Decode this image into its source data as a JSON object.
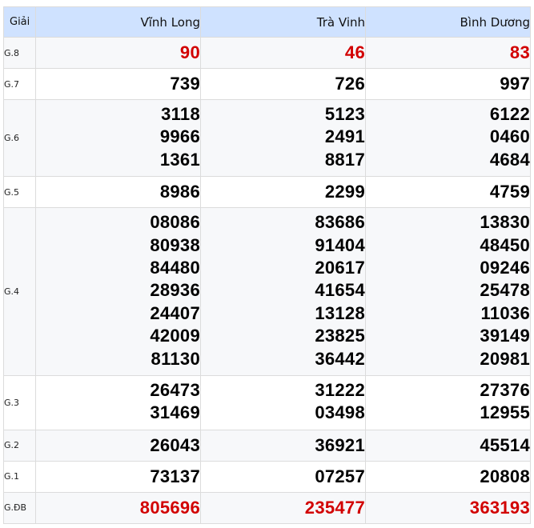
{
  "header": {
    "prize_label": "Giải",
    "stations": [
      "Vĩnh Long",
      "Trà Vinh",
      "Bình Dương"
    ]
  },
  "rows": [
    {
      "prize": "G.8",
      "values": [
        [
          "90"
        ],
        [
          "46"
        ],
        [
          "83"
        ]
      ],
      "highlight": true
    },
    {
      "prize": "G.7",
      "values": [
        [
          "739"
        ],
        [
          "726"
        ],
        [
          "997"
        ]
      ]
    },
    {
      "prize": "G.6",
      "values": [
        [
          "3118",
          "9966",
          "1361"
        ],
        [
          "5123",
          "2491",
          "8817"
        ],
        [
          "6122",
          "0460",
          "4684"
        ]
      ]
    },
    {
      "prize": "G.5",
      "values": [
        [
          "8986"
        ],
        [
          "2299"
        ],
        [
          "4759"
        ]
      ]
    },
    {
      "prize": "G.4",
      "values": [
        [
          "08086",
          "80938",
          "84480",
          "28936",
          "24407",
          "42009",
          "81130"
        ],
        [
          "83686",
          "91404",
          "20617",
          "41654",
          "13128",
          "23825",
          "36442"
        ],
        [
          "13830",
          "48450",
          "09246",
          "25478",
          "11036",
          "39149",
          "20981"
        ]
      ]
    },
    {
      "prize": "G.3",
      "values": [
        [
          "26473",
          "31469"
        ],
        [
          "31222",
          "03498"
        ],
        [
          "27376",
          "12955"
        ]
      ]
    },
    {
      "prize": "G.2",
      "values": [
        [
          "26043"
        ],
        [
          "36921"
        ],
        [
          "45514"
        ]
      ]
    },
    {
      "prize": "G.1",
      "values": [
        [
          "73137"
        ],
        [
          "07257"
        ],
        [
          "20808"
        ]
      ]
    },
    {
      "prize": "G.ĐB",
      "values": [
        [
          "805696"
        ],
        [
          "235477"
        ],
        [
          "363193"
        ]
      ],
      "highlight": true
    }
  ],
  "colors": {
    "header_bg": "#cfe2ff",
    "highlight": "#d20000",
    "number": "#000000"
  }
}
